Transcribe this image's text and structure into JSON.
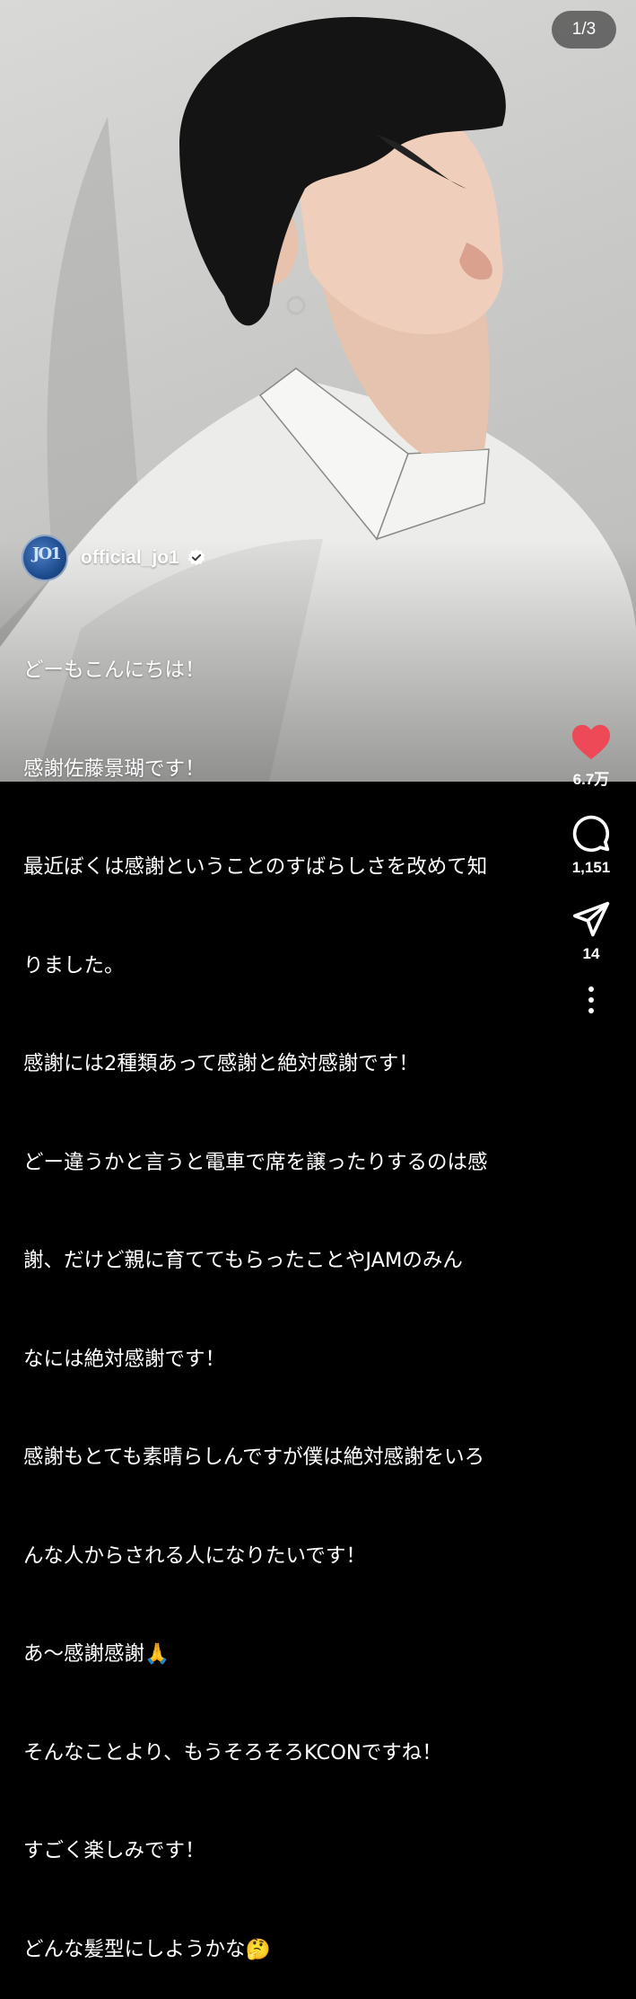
{
  "post": {
    "page_indicator": "1/3",
    "author": {
      "username": "official_jo1",
      "avatar_text": "JO1",
      "verified_icon": "verified-badge-icon"
    },
    "caption_lines": [
      "どーもこんにちは！",
      "感謝佐藤景瑚です！",
      "最近ぼくは感謝ということのすばらしさを改めて知",
      "りました。",
      "感謝には2種類あって感謝と絶対感謝です！",
      "どー違うかと言うと電車で席を譲ったりするのは感",
      "謝、だけど親に育ててもらったことやJAMのみん",
      "なには絶対感謝です！",
      "感謝もとても素晴らしんですが僕は絶対感謝をいろ",
      "んな人からされる人になりたいです！",
      "あ〜感謝感謝🙏",
      "そんなことより、もうそろそろKCONですね！",
      "すごく楽しみです！",
      "どんな髪型にしようかな🤔"
    ]
  },
  "actions": {
    "like": {
      "icon": "heart-icon",
      "count": "6.7万",
      "color": "#ed4956"
    },
    "comment": {
      "icon": "comment-icon",
      "count": "1,151"
    },
    "share": {
      "icon": "send-icon",
      "count": "14"
    },
    "more": {
      "icon": "more-vertical-icon"
    }
  }
}
